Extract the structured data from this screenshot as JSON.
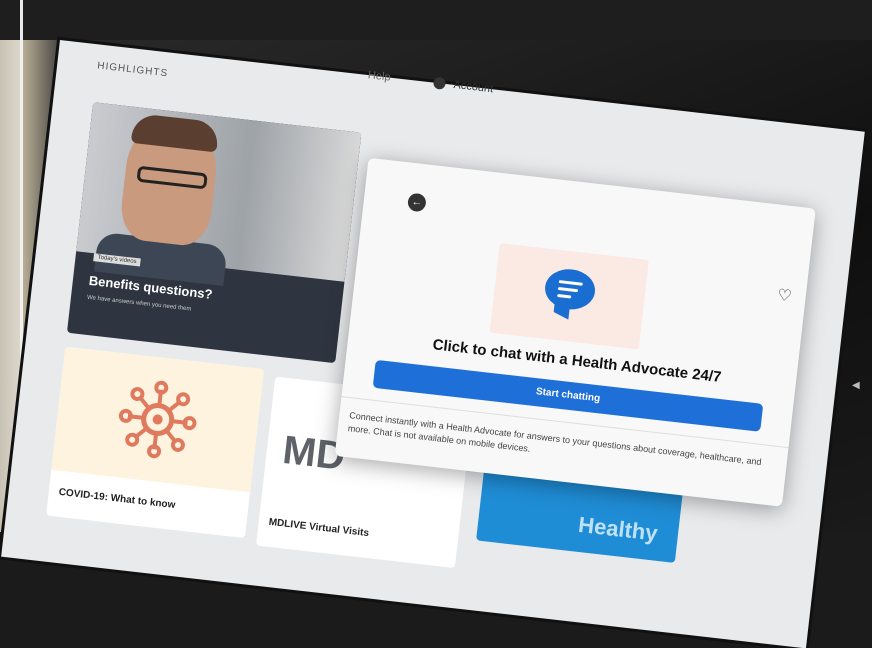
{
  "header": {
    "nav_partial": "Help",
    "account_label": "Account"
  },
  "section_title": "HIGHLIGHTS",
  "cards": {
    "benefits": {
      "tag": "Today's videos",
      "title": "Benefits questions?",
      "subtitle": "We have answers when you need them"
    },
    "covid": {
      "label": "COVID-19: What to know"
    },
    "mdlive": {
      "logo_text": "MD",
      "label": "MDLIVE Virtual Visits"
    },
    "blue_card_text": "Healthy"
  },
  "modal": {
    "headline": "Click to chat with a Health Advocate 24/7",
    "button_label": "Start chatting",
    "description": "Connect instantly with a Health Advocate for answers to your questions about coverage, healthcare, and more. Chat is not available on mobile devices."
  },
  "colors": {
    "primary_blue": "#1f6fd8",
    "illustration_bg": "#fbe9e3",
    "covid_bg": "#fdf3de",
    "covid_icon": "#e07a5f"
  },
  "icons": {
    "back": "back-arrow-icon",
    "favorite": "heart-icon",
    "chat": "chat-bubble-icon",
    "account": "account-icon",
    "virus": "virus-icon"
  }
}
